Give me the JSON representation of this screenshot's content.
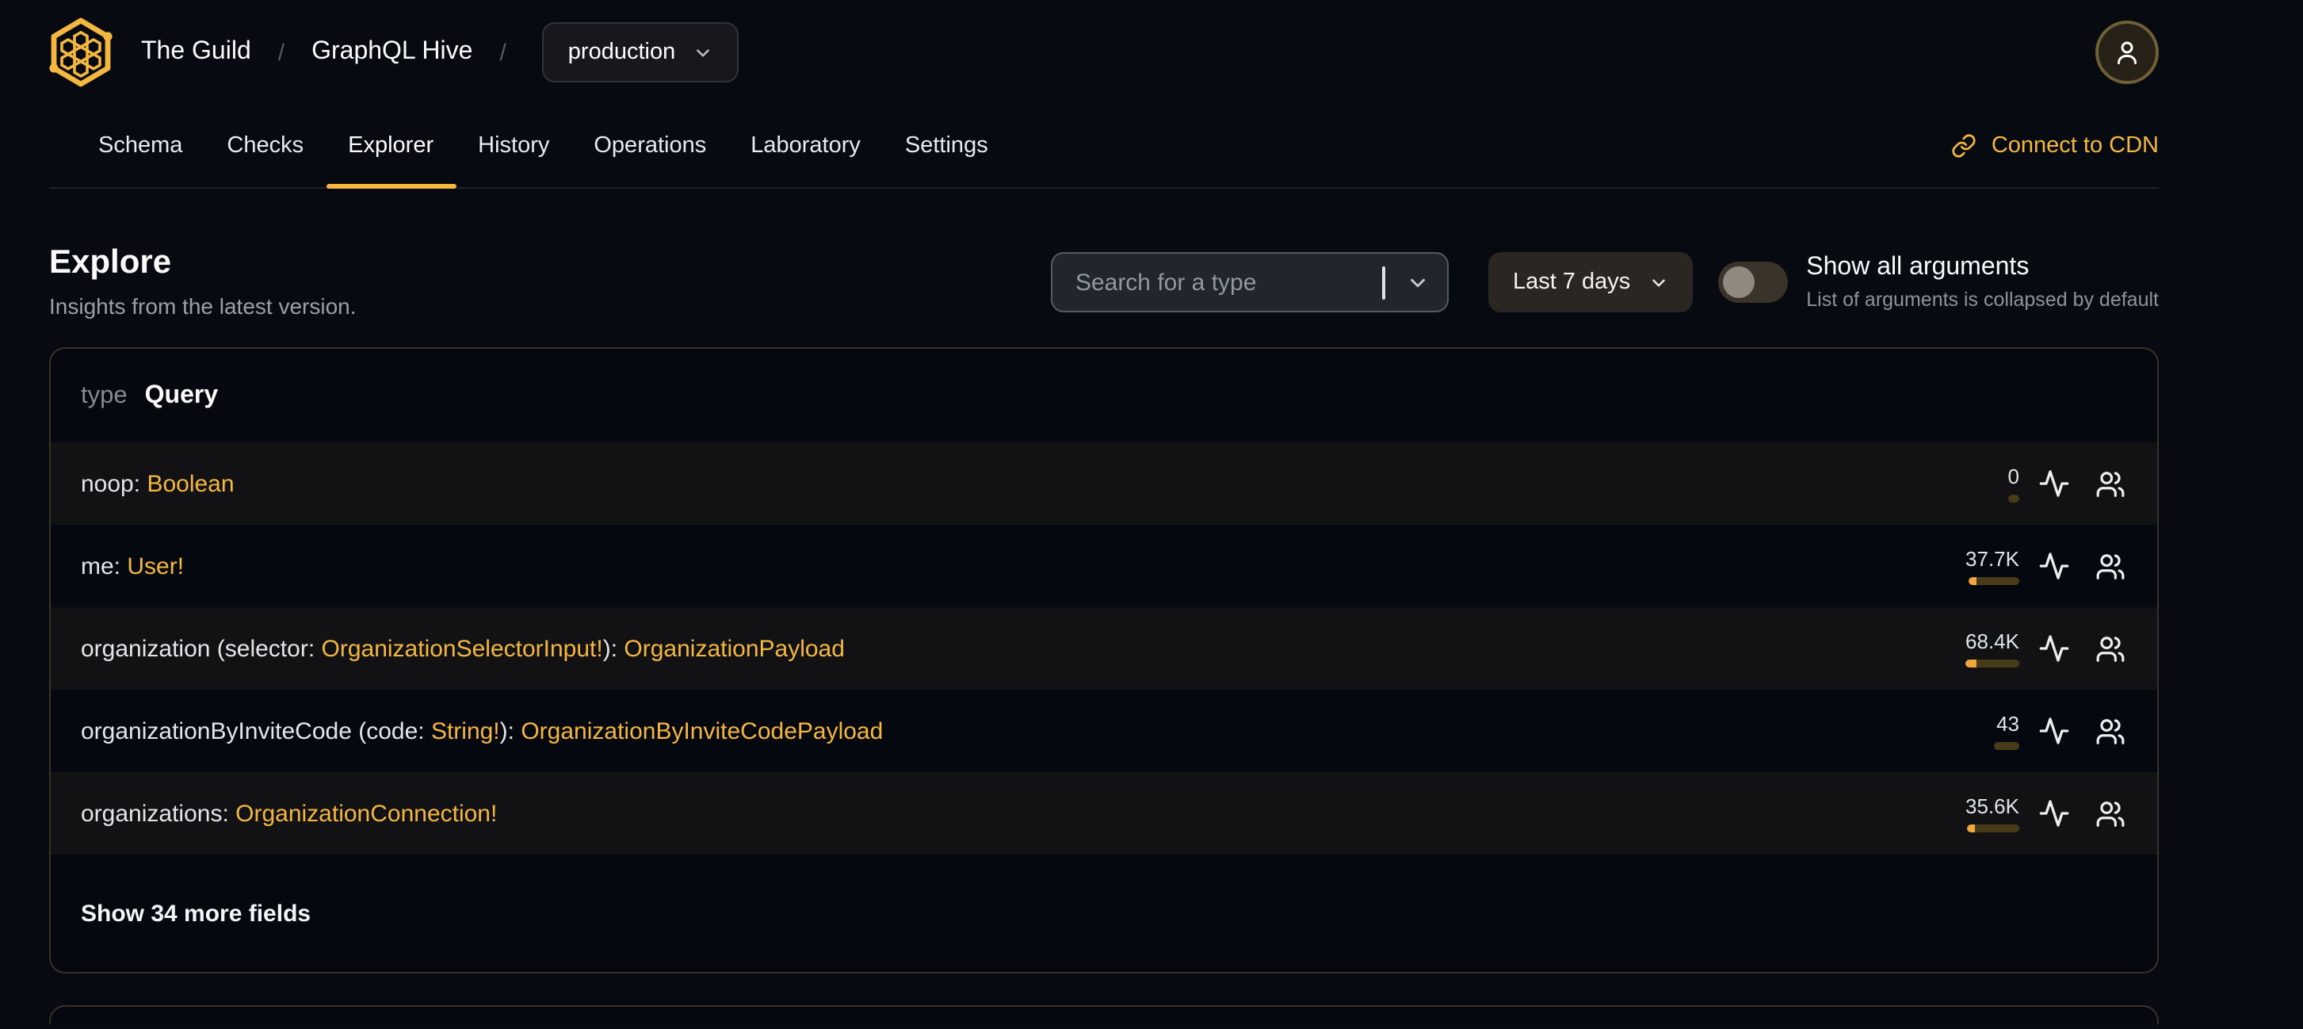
{
  "theme": {
    "accent": "#f4b740",
    "bar_fill": "#f2a73c",
    "bar_track": "#473b1a"
  },
  "brand": {
    "org_name": "The Guild",
    "separator": "/",
    "project_name": "GraphQL Hive",
    "target_selector": "production"
  },
  "nav": {
    "tabs": [
      {
        "label": "Schema",
        "active": false
      },
      {
        "label": "Checks",
        "active": false
      },
      {
        "label": "Explorer",
        "active": true
      },
      {
        "label": "History",
        "active": false
      },
      {
        "label": "Operations",
        "active": false
      },
      {
        "label": "Laboratory",
        "active": false
      },
      {
        "label": "Settings",
        "active": false
      }
    ],
    "cdn_link_label": "Connect to CDN"
  },
  "page_header": {
    "title": "Explore",
    "subtitle": "Insights from the latest version."
  },
  "controls": {
    "search": {
      "placeholder": "Search for a type"
    },
    "period": {
      "label": "Last 7 days"
    },
    "arguments_toggle": {
      "label": "Show all arguments",
      "description": "List of arguments is collapsed by default",
      "enabled": false
    }
  },
  "schema_type": {
    "keyword": "type",
    "name": "Query",
    "footer_label": "Show 34 more fields",
    "fields": [
      {
        "signature": [
          {
            "kind": "plain",
            "text": "noop: "
          },
          {
            "kind": "type",
            "text": "Boolean"
          }
        ],
        "usage_count": "0",
        "usage_track": 7,
        "usage_fill": 0
      },
      {
        "signature": [
          {
            "kind": "plain",
            "text": "me: "
          },
          {
            "kind": "type",
            "text": "User!"
          }
        ],
        "usage_count": "37.7K",
        "usage_track": 32,
        "usage_fill": 5
      },
      {
        "signature": [
          {
            "kind": "plain",
            "text": "organization (selector: "
          },
          {
            "kind": "type",
            "text": "OrganizationSelectorInput!"
          },
          {
            "kind": "plain",
            "text": "): "
          },
          {
            "kind": "type",
            "text": "OrganizationPayload"
          }
        ],
        "usage_count": "68.4K",
        "usage_track": 34,
        "usage_fill": 7
      },
      {
        "signature": [
          {
            "kind": "plain",
            "text": "organizationByInviteCode (code: "
          },
          {
            "kind": "type",
            "text": "String!"
          },
          {
            "kind": "plain",
            "text": "): "
          },
          {
            "kind": "type",
            "text": "OrganizationByInviteCodePayload"
          }
        ],
        "usage_count": "43",
        "usage_track": 16,
        "usage_fill": 0
      },
      {
        "signature": [
          {
            "kind": "plain",
            "text": "organizations: "
          },
          {
            "kind": "type",
            "text": "OrganizationConnection!"
          }
        ],
        "usage_count": "35.6K",
        "usage_track": 33,
        "usage_fill": 5
      }
    ]
  }
}
